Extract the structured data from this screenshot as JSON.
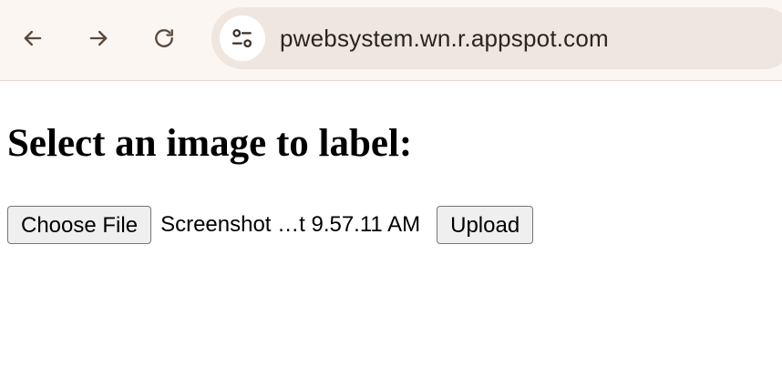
{
  "browser": {
    "url": "pwebsystem.wn.r.appspot.com",
    "icons": {
      "back": "arrow-left-icon",
      "forward": "arrow-right-icon",
      "reload": "reload-icon",
      "site_info": "tune-icon"
    },
    "colors": {
      "toolbar": "#fbf6f2",
      "omnibox": "#efe6e0",
      "icon": "#5a4a3e"
    }
  },
  "page": {
    "heading": "Select an image to label:",
    "file_input": {
      "button_label": "Choose File",
      "selected_file": "Screenshot …t 9.57.11 AM"
    },
    "upload_label": "Upload"
  }
}
